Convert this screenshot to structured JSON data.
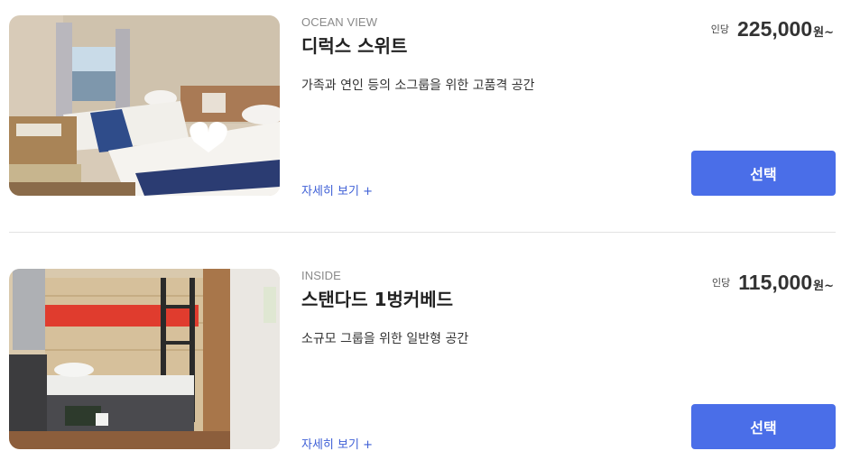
{
  "rooms": [
    {
      "category": "OCEAN VIEW",
      "name": "디럭스 스위트",
      "description": "가족과 연인 등의 소그룹을 위한 고품격 공간",
      "price_prefix": "인당",
      "price": "225,000",
      "price_unit": "원~",
      "detail_link": "자세히 보기 +",
      "select_label": "선택",
      "image_icon": "hotel-room-photo"
    },
    {
      "category": "INSIDE",
      "name": "스탠다드 1벙커베드",
      "description": "소규모 그룹을 위한 일반형 공간",
      "price_prefix": "인당",
      "price": "115,000",
      "price_unit": "원~",
      "detail_link": "자세히 보기 +",
      "select_label": "선택",
      "image_icon": "bunk-bed-cabin-photo"
    }
  ],
  "colors": {
    "accent": "#4a6ee8",
    "link": "#3e5fd6",
    "divider": "#e3e3e3"
  }
}
